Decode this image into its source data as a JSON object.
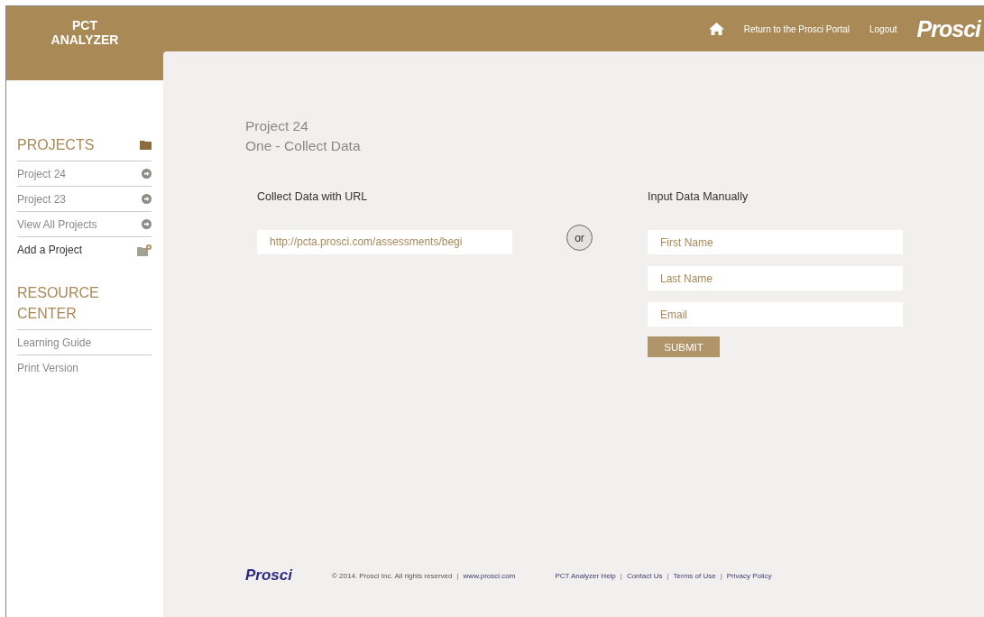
{
  "app_title": [
    "PCT",
    "ANALYZER"
  ],
  "header": {
    "links": [
      "Return to the Prosci Portal",
      "Logout"
    ],
    "brand": "Prosci"
  },
  "sidebar": {
    "sections": [
      {
        "title": "PROJECTS",
        "items": [
          {
            "label": "Project 24",
            "kind": "arrow"
          },
          {
            "label": "Project 23",
            "kind": "arrow"
          },
          {
            "label": "View All Projects",
            "kind": "arrow"
          },
          {
            "label": "Add a Project",
            "kind": "add"
          }
        ]
      },
      {
        "title": "RESOURCE CENTER",
        "items": [
          {
            "label": "Learning Guide",
            "kind": "plain"
          },
          {
            "label": "Print Version",
            "kind": "plain"
          }
        ]
      }
    ]
  },
  "page": {
    "title": "Project 24",
    "subtitle": "One - Collect Data"
  },
  "collect": {
    "heading": "Collect Data with URL",
    "url": "http://pcta.prosci.com/assessments/begi"
  },
  "separator": "or",
  "manual": {
    "heading": "Input Data Manually",
    "fields": [
      {
        "placeholder": "First Name"
      },
      {
        "placeholder": "Last Name"
      },
      {
        "placeholder": "Email"
      }
    ],
    "submit": "SUBMIT"
  },
  "footer": {
    "brand": "Prosci",
    "divider": "|",
    "copyright": "© 2014. Prosci Inc. All rights reserved",
    "site": "www.prosci.com",
    "links": [
      "PCT Analyzer Help",
      "Contact Us",
      "Terms of Use",
      "Privacy Policy"
    ]
  }
}
